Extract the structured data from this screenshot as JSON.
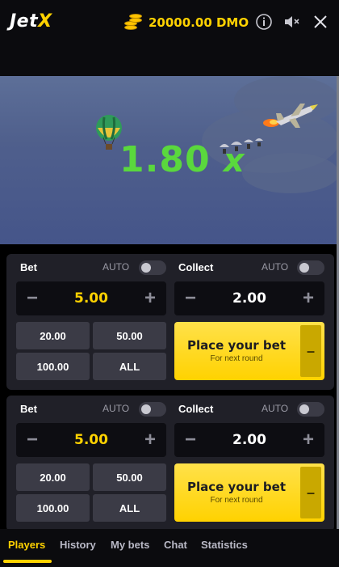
{
  "header": {
    "logo_part1": "Jet",
    "logo_part2": "X",
    "balance": "20000.00 DMO",
    "icons": [
      "coins-icon",
      "info-icon",
      "mute-icon",
      "close-icon"
    ]
  },
  "game": {
    "multiplier_value": "1.80",
    "multiplier_suffix": "x",
    "multiplier_color": "#5ad83d"
  },
  "bets": [
    {
      "bet_label": "Bet",
      "bet_auto": "AUTO",
      "bet_value": "5.00",
      "collect_label": "Collect",
      "collect_auto": "AUTO",
      "collect_value": "2.00",
      "chips": [
        "20.00",
        "50.00",
        "100.00",
        "ALL"
      ],
      "place_title": "Place your bet",
      "place_sub": "For next round",
      "place_side": "–"
    },
    {
      "bet_label": "Bet",
      "bet_auto": "AUTO",
      "bet_value": "5.00",
      "collect_label": "Collect",
      "collect_auto": "AUTO",
      "collect_value": "2.00",
      "chips": [
        "20.00",
        "50.00",
        "100.00",
        "ALL"
      ],
      "place_title": "Place your bet",
      "place_sub": "For next round",
      "place_side": "–"
    }
  ],
  "tabs": [
    "Players",
    "History",
    "My bets",
    "Chat",
    "Statistics"
  ],
  "active_tab": "Players",
  "colors": {
    "accent": "#ffd200",
    "panel": "#202028",
    "background": "#000000"
  }
}
